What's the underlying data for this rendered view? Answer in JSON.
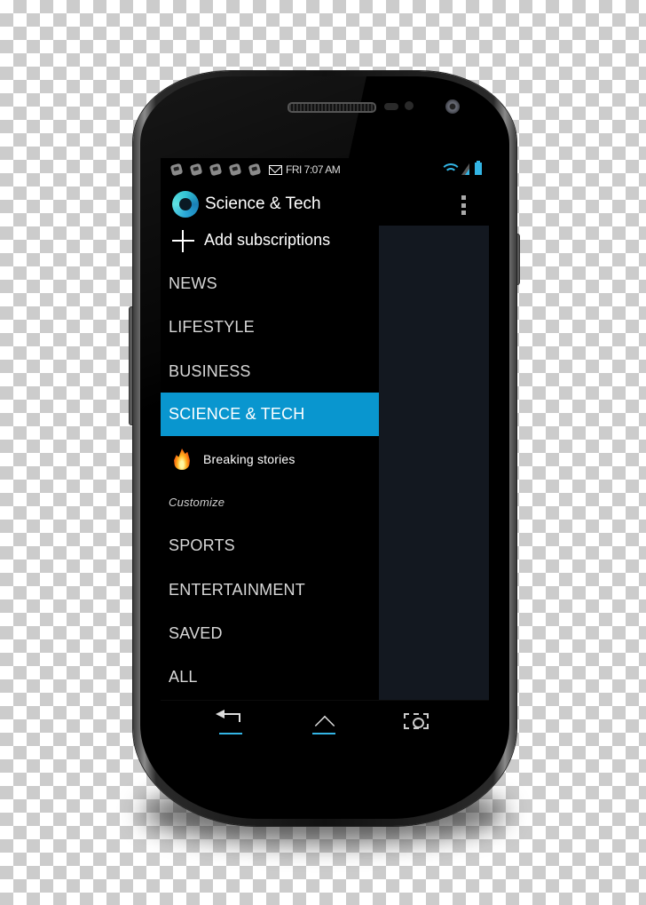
{
  "status_bar": {
    "notification_icons": [
      "app-notification-icon",
      "app-notification-icon",
      "app-notification-icon",
      "app-notification-icon",
      "app-notification-icon"
    ],
    "mail_icon": "gmail-icon",
    "time": "FRI 7:07 AM",
    "icons": [
      "wifi-icon",
      "signal-icon",
      "battery-icon"
    ]
  },
  "action_bar": {
    "title": "Science & Tech",
    "logo_icon": "app-logo-icon",
    "overflow_icon": "overflow-menu-icon"
  },
  "drawer": {
    "add_subscriptions_label": "Add subscriptions",
    "items": [
      {
        "label": "NEWS",
        "type": "category",
        "selected": false
      },
      {
        "label": "LIFESTYLE",
        "type": "category",
        "selected": false
      },
      {
        "label": "BUSINESS",
        "type": "category",
        "selected": false
      },
      {
        "label": "SCIENCE & TECH",
        "type": "category",
        "selected": true
      },
      {
        "label": "Breaking stories",
        "type": "subitem",
        "icon": "fire-icon",
        "selected": false
      },
      {
        "label": "Customize",
        "type": "header",
        "selected": false
      },
      {
        "label": "SPORTS",
        "type": "category",
        "selected": false
      },
      {
        "label": "ENTERTAINMENT",
        "type": "category",
        "selected": false
      },
      {
        "label": "SAVED",
        "type": "category",
        "selected": false
      },
      {
        "label": "ALL",
        "type": "category",
        "selected": false
      }
    ]
  },
  "nav_bar": {
    "buttons": [
      "back",
      "home",
      "recent-apps"
    ]
  },
  "colors": {
    "accent": "#0996cf",
    "status_icon": "#33b5e5",
    "main_pane": "#131820"
  }
}
